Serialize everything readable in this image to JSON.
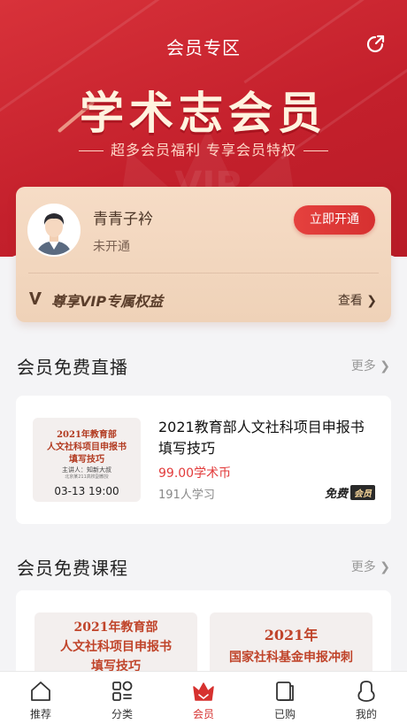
{
  "header": {
    "title": "会员专区",
    "share_icon": "share-icon"
  },
  "hero": {
    "title": "学术志会员",
    "subtitle": "超多会员福利 专享会员特权",
    "watermark": "VIP"
  },
  "member_card": {
    "user_name": "青青子衿",
    "status": "未开通",
    "open_button": "立即开通",
    "benefit_text": "尊享VIP专属权益",
    "view_link": "查看"
  },
  "live_section": {
    "title": "会员免费直播",
    "more": "更多",
    "items": [
      {
        "thumb_line1": "2021年教育部",
        "thumb_line2": "人文社科项目申报书",
        "thumb_line3": "填写技巧",
        "thumb_speaker": "主讲人：知新大叔",
        "thumb_speaker_note": "北京某211高校副教授",
        "thumb_date": "03-13 19:00",
        "title": "2021教育部人文社科项目申报书填写技巧",
        "price": "99.00学术币",
        "learners": "191人学习",
        "free_label": "免费",
        "member_badge": "会员"
      }
    ]
  },
  "course_section": {
    "title": "会员免费课程",
    "more": "更多",
    "items": [
      {
        "line1": "2021年教育部",
        "line2": "人文社科项目申报书",
        "line3": "填写技巧"
      },
      {
        "line1": "2021年",
        "line2": "国家社科基金申报冲刺",
        "line3": ""
      }
    ]
  },
  "tab_bar": {
    "items": [
      {
        "label": "推荐",
        "icon": "home-icon"
      },
      {
        "label": "分类",
        "icon": "category-icon"
      },
      {
        "label": "会员",
        "icon": "crown-icon"
      },
      {
        "label": "已购",
        "icon": "purchased-icon"
      },
      {
        "label": "我的",
        "icon": "profile-icon"
      }
    ],
    "active_index": 2
  },
  "colors": {
    "brand_red": "#d6312f",
    "hero_red": "#c4202c",
    "card_gold": "#f2d8c2"
  }
}
